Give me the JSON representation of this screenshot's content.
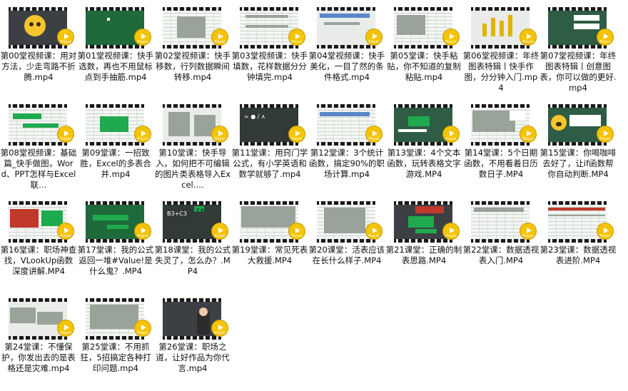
{
  "player_badge": "Player",
  "items": [
    {
      "title": "第00堂视频课：用对方法，少走弯路不折腾.mp4"
    },
    {
      "title": "第01堂视频课：快手选数，再也不用鼠标点到手抽筋.mp4"
    },
    {
      "title": "第02堂视频课：快手移数，行列数据瞬间转移.mp4"
    },
    {
      "title": "第03堂视频课：快手填数，花样数据分分钟填完.mp4"
    },
    {
      "title": "第04堂视频课：快手美化，一目了然的条件格式.mp4"
    },
    {
      "title": "第05堂课：快手粘贴，你不知道的复制粘贴.mp4"
    },
    {
      "title": "第06堂视频课：年终图表特辑丨快手作图，分分钟入门.mp4"
    },
    {
      "title": "第07堂视频课：年终图表特辑丨创意图表，你可以做的更好.mp4"
    },
    {
      "title": "第08堂视频课：基础篇_快手做图，Word、PPT怎样与Excel联…"
    },
    {
      "title": "第09堂课：一招致胜，Excel的多表合并.mp4"
    },
    {
      "title": "第10堂课：快手导入，如何把不可编辑的图片类表格导入Excel.…"
    },
    {
      "title": "第11堂课：用窍门学公式，有小学英语和数学就够了.mp4"
    },
    {
      "title": "第12堂课：3个统计函数，搞定90%的职场计算.mp4"
    },
    {
      "title": "第13堂课：4个文本函数，玩转表格文字游戏.MP4"
    },
    {
      "title": "第14堂课：5个日期函数，不用看着日历数日子.MP4"
    },
    {
      "title": "第15堂课：你喝咖啡去好了，让if函数帮你自动判断.MP4"
    },
    {
      "title": "第16堂课：职场神查找，VLookUp函数深度讲解.MP4"
    },
    {
      "title": "第17堂课：我的公式返回一堆#Value!是什么鬼？.MP4"
    },
    {
      "title": "第18课堂：我的公式失灵了，怎么办？.MP4"
    },
    {
      "title": "第19堂课：常见死表大救援.MP4"
    },
    {
      "title": "第20课堂：活表应该在长什么样子.MP4"
    },
    {
      "title": "第21课堂：正确的制表思路.MP4"
    },
    {
      "title": "第22堂课：数据透视表入门.MP4"
    },
    {
      "title": "第23堂课：数据透视表进阶.MP4"
    },
    {
      "title": "第24堂课：不懂保护，你发出去的是表格还是灾难.mp4"
    },
    {
      "title": "第25堂课：不用抓狂，5招搞定各种打印问题.mp4"
    },
    {
      "title": "第26堂课：职场之道，让好作品为你代言.mp4"
    }
  ],
  "thumb_texts": {
    "t11": "= ● / ∧",
    "t18": "B3+C3",
    "t18b": "文本"
  }
}
